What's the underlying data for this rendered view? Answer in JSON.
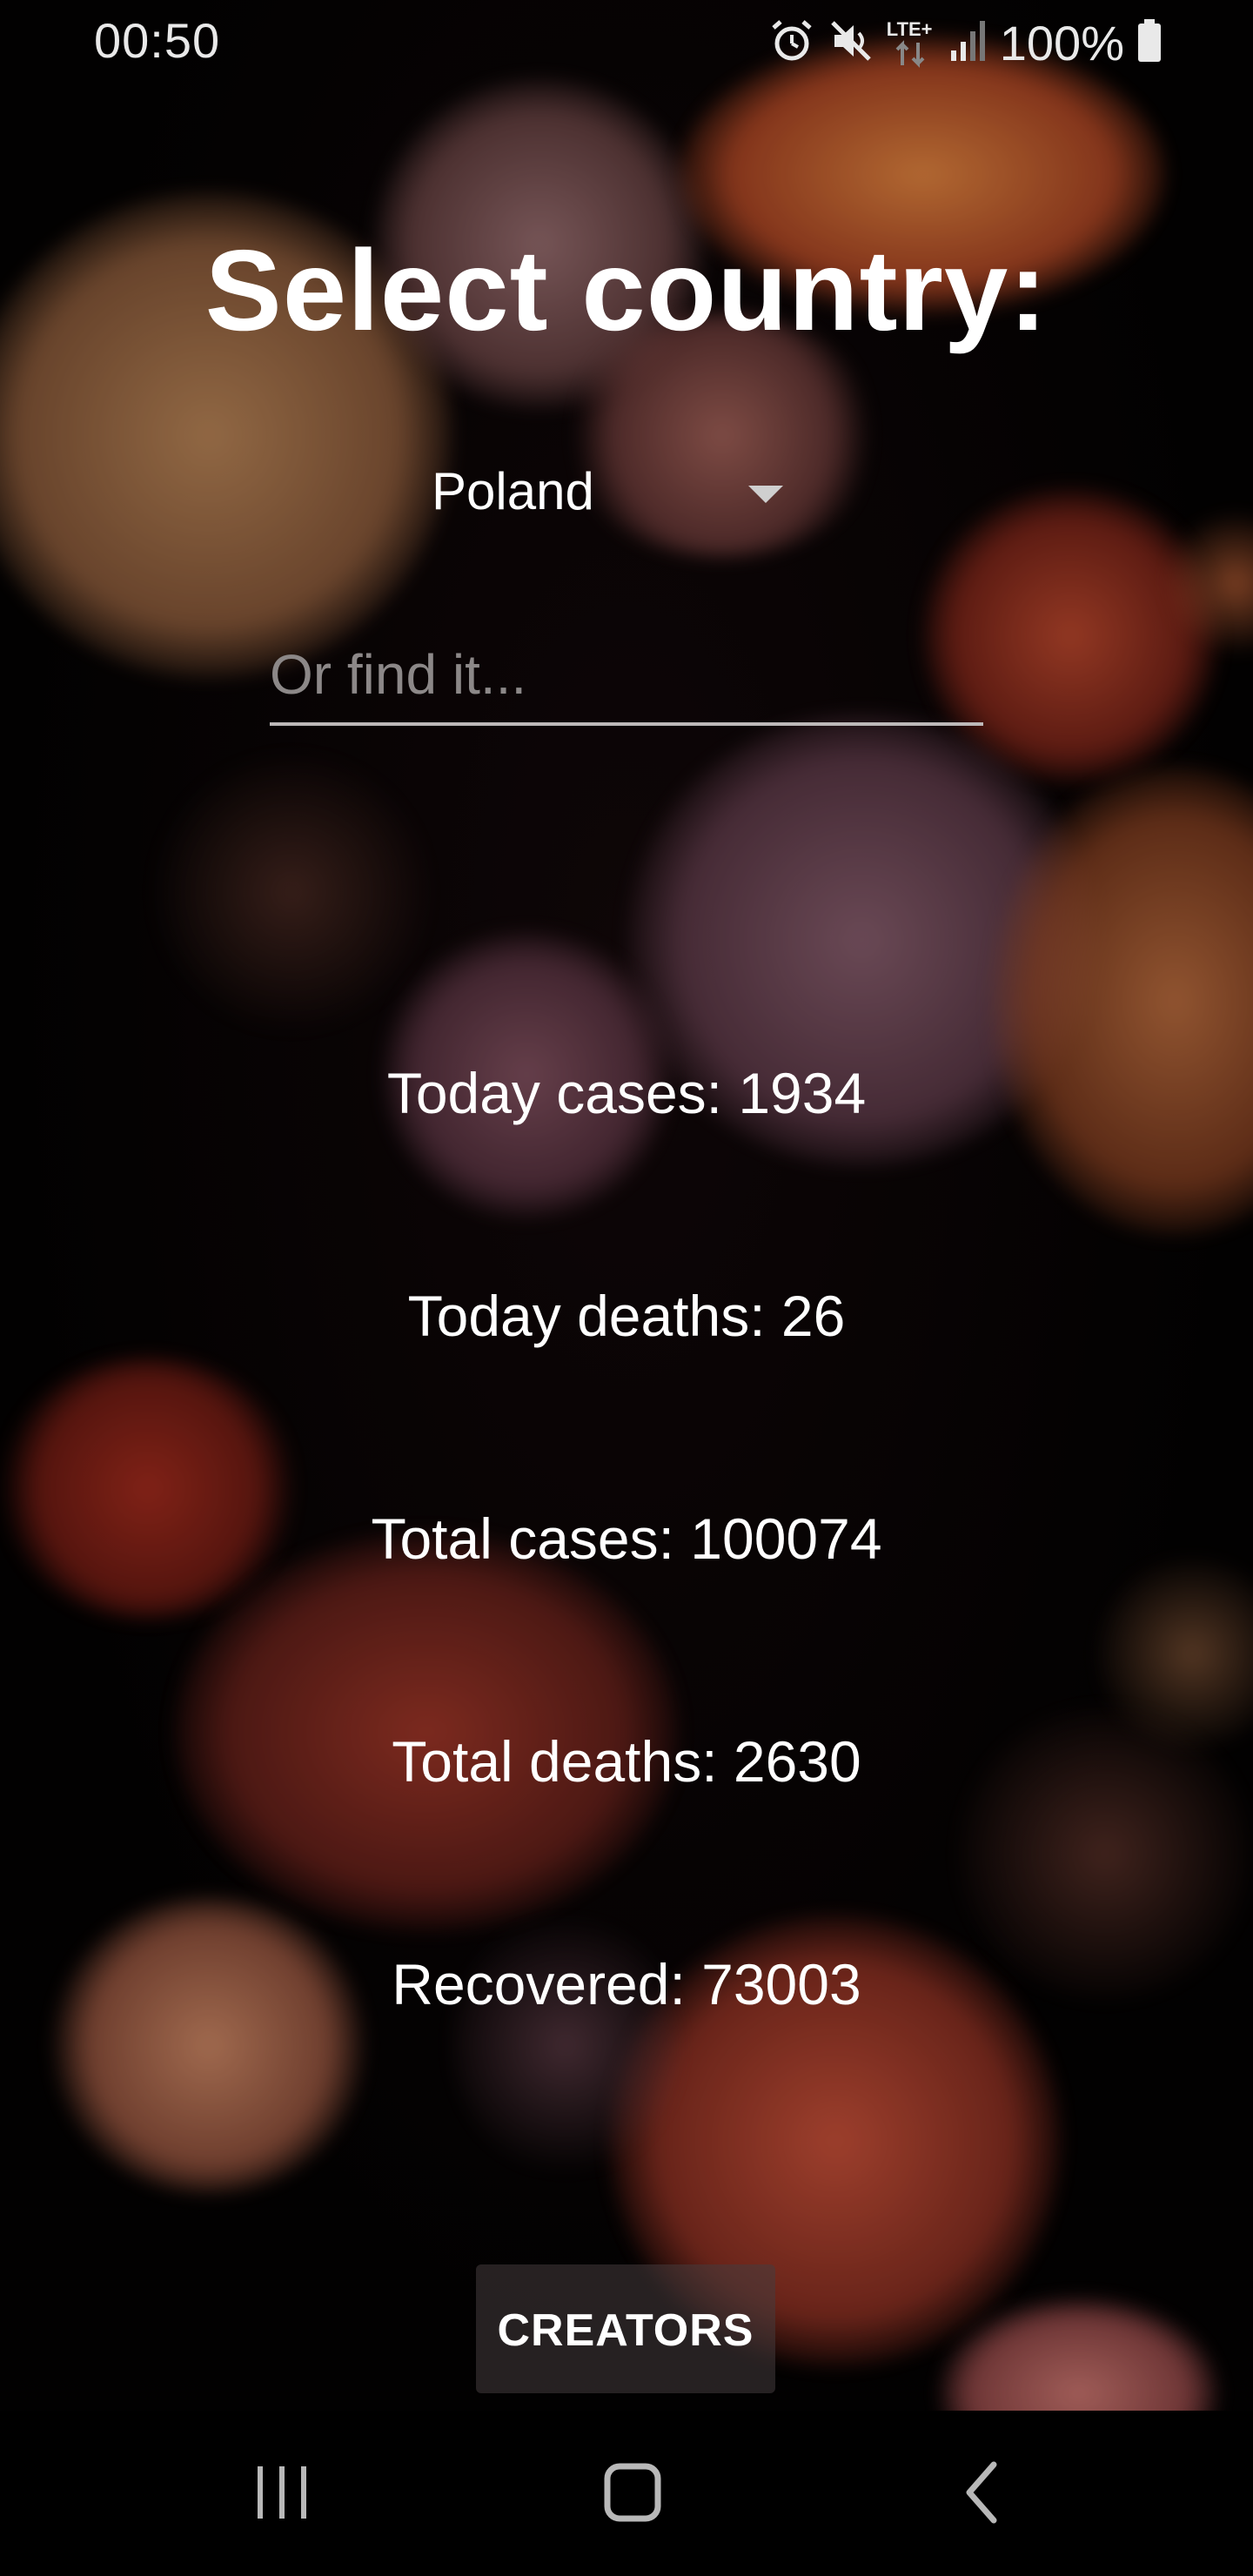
{
  "status_bar": {
    "time": "00:50",
    "network_label": "LTE+",
    "battery": "100%",
    "icons": [
      "alarm-icon",
      "mute-icon",
      "lte-icon",
      "signal-icon",
      "battery-icon"
    ]
  },
  "header": {
    "title": "Select country:"
  },
  "country_selector": {
    "selected": "Poland",
    "icon": "dropdown-arrow-icon"
  },
  "search": {
    "placeholder": "Or find it...",
    "value": ""
  },
  "stats": [
    {
      "label": "Today cases: 1934"
    },
    {
      "label": "Today deaths: 26"
    },
    {
      "label": "Total cases: 100074"
    },
    {
      "label": "Total deaths: 2630"
    },
    {
      "label": "Recovered: 73003"
    }
  ],
  "footer": {
    "creators_label": "CREATORS"
  },
  "nav_bar": {
    "icons": [
      "recent-apps-icon",
      "home-icon",
      "back-icon"
    ]
  },
  "colors": {
    "text": "#ffffff",
    "placeholder": "#8c8888",
    "underline": "#bdb9b9",
    "button_bg": "#463c3e"
  }
}
